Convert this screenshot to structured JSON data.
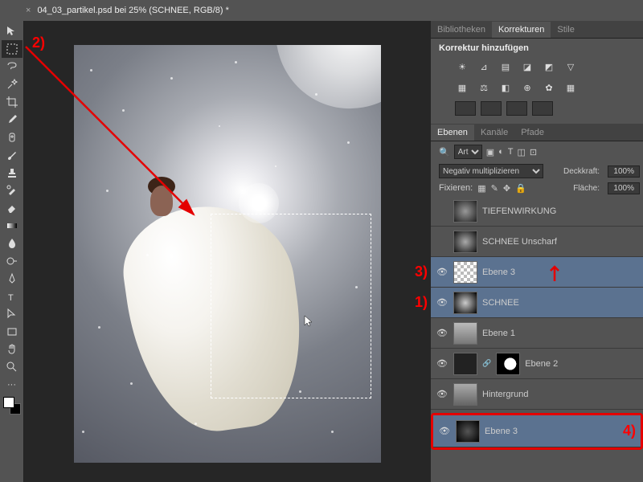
{
  "titlebar": {
    "close_glyph": "×",
    "document_title": "04_03_partikel.psd bei 25% (SCHNEE, RGB/8) *"
  },
  "annotations": {
    "step1": "1)",
    "step2": "2)",
    "step3": "3)",
    "step4": "4)"
  },
  "panels": {
    "top_tabs": [
      "Bibliotheken",
      "Korrekturen",
      "Stile"
    ],
    "active_top": 1,
    "korr_title": "Korrektur hinzufügen",
    "adj_icons_row1": [
      "☀",
      "⊿",
      "▤",
      "◪",
      "◩",
      "▽"
    ],
    "adj_icons_row2": [
      "▦",
      "⚖",
      "◧",
      "⊕",
      "✿",
      "▦"
    ],
    "layer_tabs": [
      "Ebenen",
      "Kanäle",
      "Pfade"
    ],
    "active_layer_tab": 0,
    "filter_label": "Art",
    "filter_icons": [
      "▾",
      "▣",
      "◐",
      "T",
      "◫",
      "⊡"
    ],
    "blend_mode": "Negativ multiplizieren",
    "opacity_label": "Deckkraft:",
    "opacity_value": "100%",
    "lock_label": "Fixieren:",
    "fill_label": "Fläche:",
    "fill_value": "100%"
  },
  "layers": [
    {
      "visible": false,
      "name": "TIEFENWIRKUNG",
      "selected": false
    },
    {
      "visible": false,
      "name": "SCHNEE Unscharf",
      "selected": false
    },
    {
      "visible": true,
      "name": "Ebene 3",
      "selected": true,
      "checker": true
    },
    {
      "visible": true,
      "name": "SCHNEE",
      "selected": true
    },
    {
      "visible": true,
      "name": "Ebene 1",
      "selected": false
    },
    {
      "visible": true,
      "name": "Ebene 2",
      "selected": false,
      "mask": true
    },
    {
      "visible": true,
      "name": "Hintergrund",
      "selected": false
    }
  ],
  "extra_layer": {
    "visible": true,
    "name": "Ebene 3"
  }
}
